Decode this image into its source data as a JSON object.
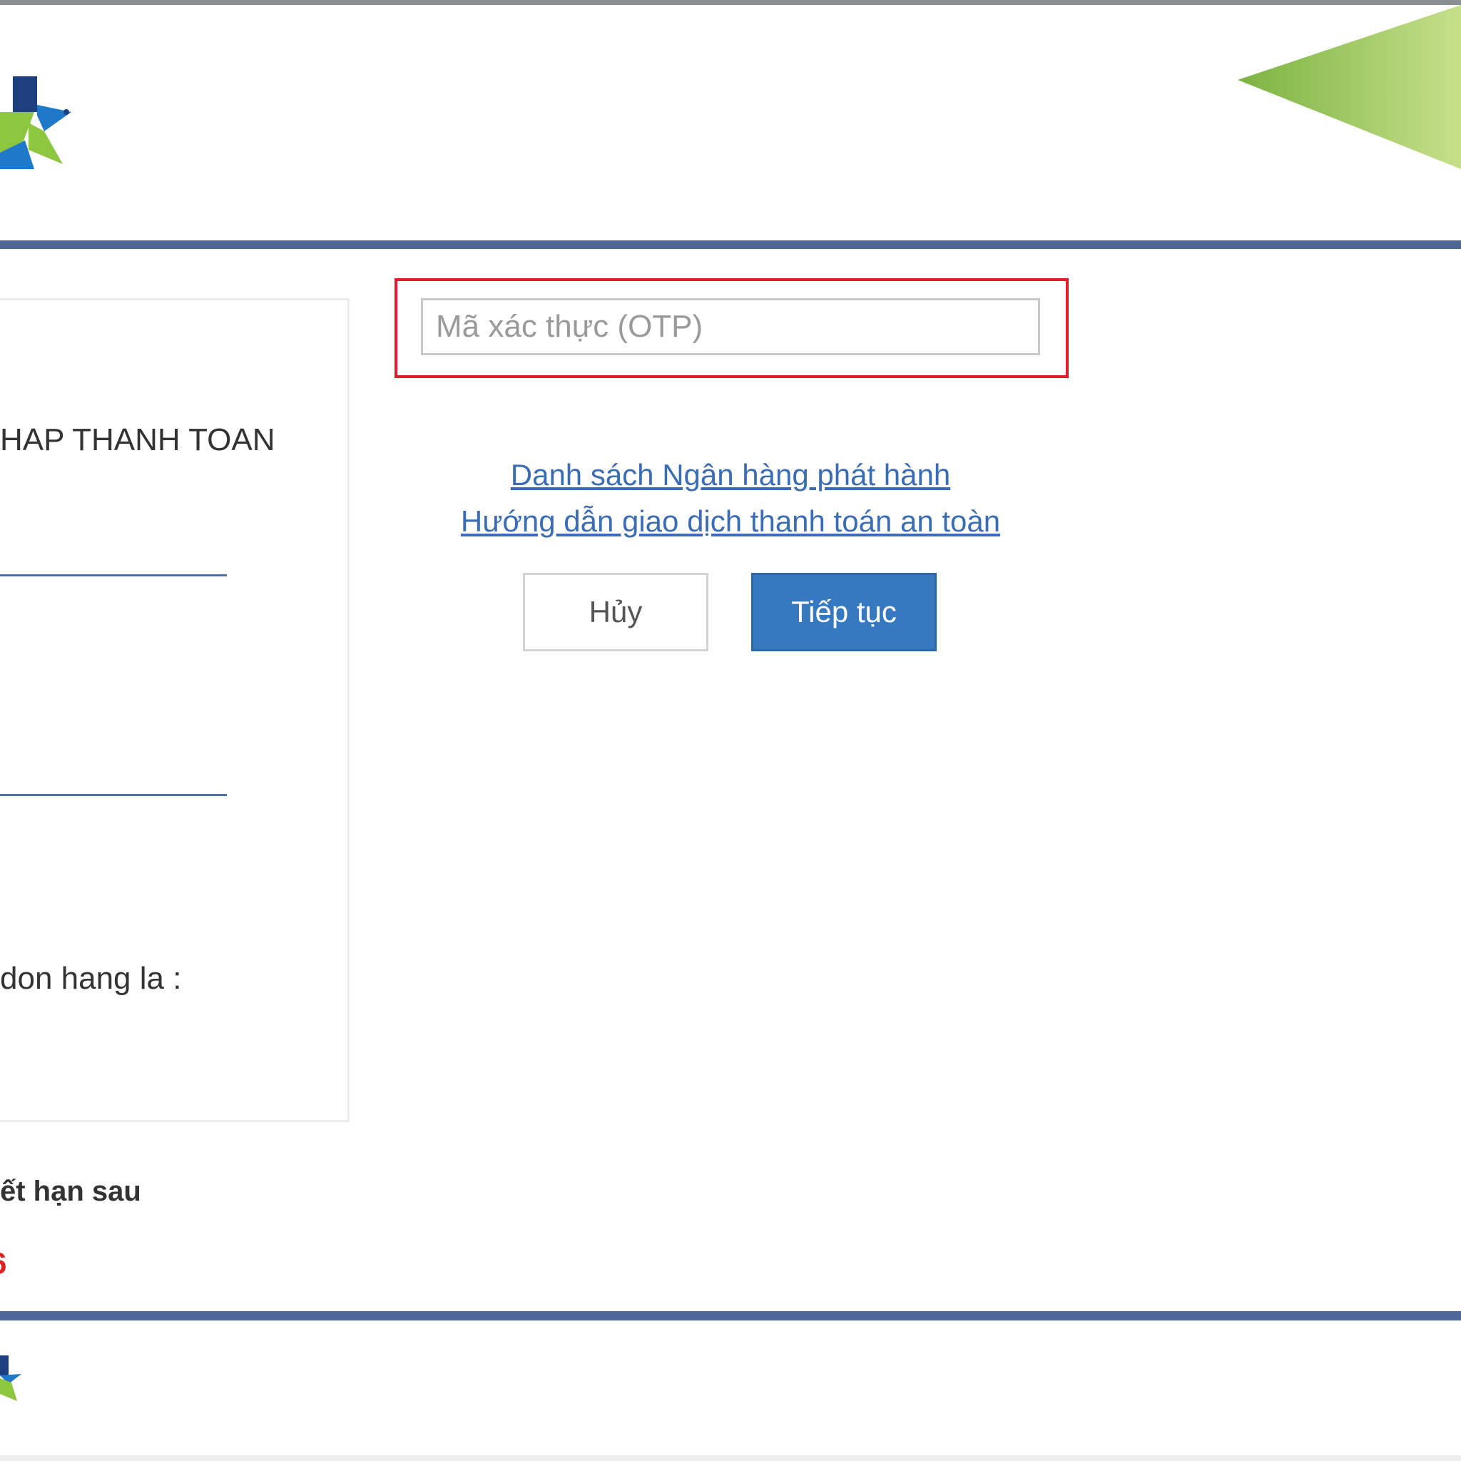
{
  "otp": {
    "placeholder": "Mã xác thực (OTP)",
    "value": ""
  },
  "links": {
    "issuing_banks": "Danh sách Ngân hàng phát hành",
    "safe_payment_guide": "Hướng dẫn giao dịch thanh toán an toàn"
  },
  "buttons": {
    "cancel": "Hủy",
    "continue": "Tiếp tục"
  },
  "info_panel": {
    "title": "HAP THANH TOAN",
    "order_text": "don hang la :"
  },
  "expiry": {
    "label": "ết hạn sau",
    "value": "6"
  },
  "colors": {
    "header_bar": "#4f6797",
    "highlight": "#e41d2c",
    "link": "#3a6db5",
    "primary_button": "#3679c0",
    "expiry_value": "#e32021",
    "logo_navy": "#1d3f80",
    "logo_blue": "#1f78c8",
    "logo_green": "#8dc63f"
  },
  "icons": {
    "header_logo": "star-logo-icon",
    "footer_logo": "star-logo-icon",
    "header_decoration": "green-triangle-decoration"
  }
}
